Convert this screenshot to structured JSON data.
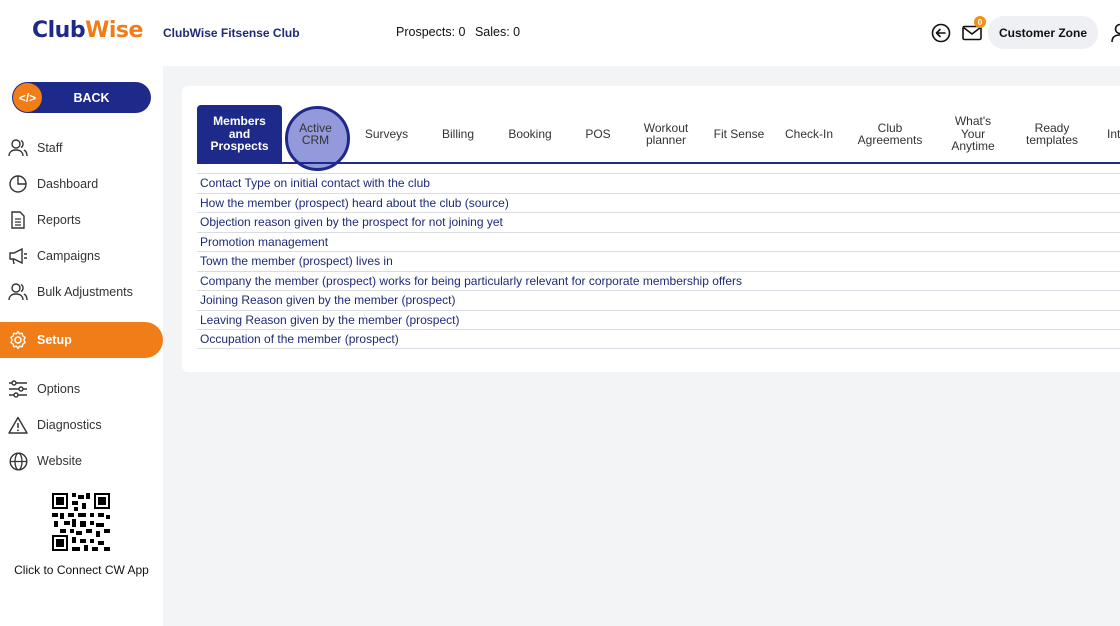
{
  "header": {
    "logo_part1": "Club",
    "logo_part2": "Wise",
    "club_name": "ClubWise Fitsense Club",
    "prospects": "Prospects: 0",
    "sales": "Sales: 0",
    "mail_count": "0",
    "customer_zone": "Customer Zone"
  },
  "sidebar": {
    "back_label": "BACK",
    "back_icon_text": "</>",
    "items": [
      {
        "label": "Staff",
        "icon": "staff-icon"
      },
      {
        "label": "Dashboard",
        "icon": "dashboard-icon"
      },
      {
        "label": "Reports",
        "icon": "reports-icon"
      },
      {
        "label": "Campaigns",
        "icon": "megaphone-icon"
      },
      {
        "label": "Bulk Adjustments",
        "icon": "users-icon"
      },
      {
        "label": "Setup",
        "icon": "gear-icon"
      },
      {
        "label": "Options",
        "icon": "sliders-icon"
      },
      {
        "label": "Diagnostics",
        "icon": "warning-icon"
      },
      {
        "label": "Website",
        "icon": "globe-icon"
      }
    ],
    "active_item": "Setup",
    "qr_caption": "Click to Connect CW App"
  },
  "tabs": [
    {
      "label": "Members and Prospects"
    },
    {
      "label": "Active CRM"
    },
    {
      "label": "Surveys"
    },
    {
      "label": "Billing"
    },
    {
      "label": "Booking"
    },
    {
      "label": "POS"
    },
    {
      "label": "Workout planner"
    },
    {
      "label": "Fit Sense"
    },
    {
      "label": "Check-In"
    },
    {
      "label": "Club Agreements"
    },
    {
      "label": "What's Your Anytime"
    },
    {
      "label": "Ready templates"
    },
    {
      "label": "Int"
    }
  ],
  "list_items": [
    "Contact Type on initial contact with the club",
    "How the member (prospect) heard about the club (source)",
    "Objection reason given by the prospect for not joining yet",
    "Promotion management",
    "Town the member (prospect) lives in",
    "Company the member (prospect) works for being particularly relevant for corporate membership offers",
    "Joining Reason given by the member (prospect)",
    "Leaving Reason given by the member (prospect)",
    "Occupation of the member (prospect)"
  ],
  "colors": {
    "brand_blue": "#1e2a8a",
    "brand_orange": "#f07d18"
  }
}
